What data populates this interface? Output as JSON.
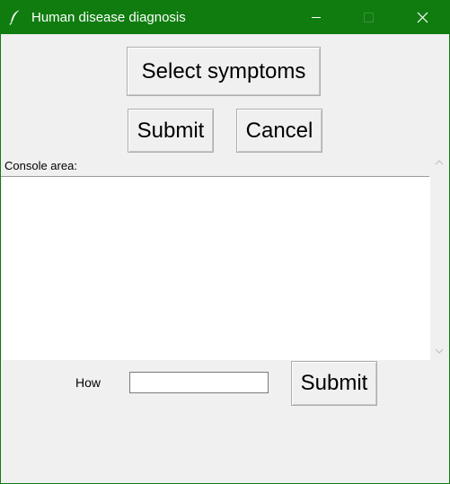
{
  "window": {
    "title": "Human disease diagnosis",
    "icon": "feather-icon",
    "titlebar_color": "#107c10",
    "background_color": "#f0f0f0"
  },
  "titlebar_buttons": {
    "minimize_icon": "minimize-icon",
    "maximize_icon": "maximize-icon",
    "close_icon": "close-icon"
  },
  "actions": {
    "select_symptoms_label": "Select symptoms",
    "submit_label": "Submit",
    "cancel_label": "Cancel"
  },
  "console": {
    "label": "Console area:",
    "content": ""
  },
  "scrollbar": {
    "up_icon": "chevron-up-icon",
    "down_icon": "chevron-down-icon"
  },
  "how_row": {
    "label": "How",
    "input_value": "",
    "submit_label": "Submit"
  }
}
